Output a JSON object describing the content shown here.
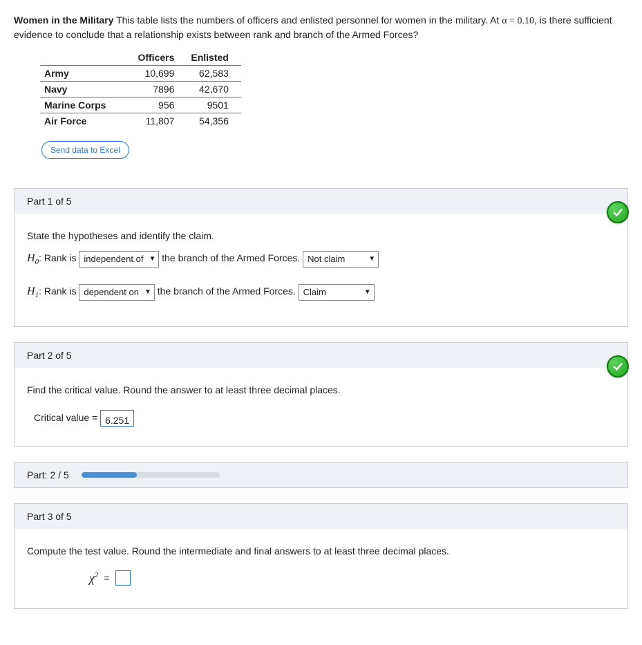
{
  "prompt": {
    "title_bold": "Women in the Military",
    "text_1": " This table lists the numbers of officers and enlisted personnel for women in the military. At ",
    "alpha_expr": "α = 0.10",
    "text_2": ", is there sufficient evidence to conclude that a relationship exists between rank and branch of the Armed Forces?"
  },
  "table": {
    "headers": {
      "c1": "Officers",
      "c2": "Enlisted"
    },
    "rows": [
      {
        "label": "Army",
        "c1": "10,699",
        "c2": "62,583"
      },
      {
        "label": "Navy",
        "c1": "7896",
        "c2": "42,670"
      },
      {
        "label": "Marine Corps",
        "c1": "956",
        "c2": "9501"
      },
      {
        "label": "Air Force",
        "c1": "11,807",
        "c2": "54,356"
      }
    ]
  },
  "excel_button": "Send data to Excel",
  "part1": {
    "header": "Part 1 of 5",
    "instruction": "State the hypotheses and identify the claim.",
    "h0_label": "H",
    "h0_sub": "0",
    "h1_label": "H",
    "h1_sub": "1",
    "rank_is": ": Rank is ",
    "h0_select": "independent of",
    "h1_select": "dependent on",
    "mid_text": " the branch of the Armed Forces. ",
    "h0_claim": "Not claim",
    "h1_claim": "Claim"
  },
  "part2": {
    "header": "Part 2 of 5",
    "instruction": "Find the critical value. Round the answer to at least three decimal places.",
    "label": "Critical value = ",
    "value": "6.251"
  },
  "progress": {
    "label": "Part: 2 / 5",
    "percent": 40
  },
  "part3": {
    "header": "Part 3 of 5",
    "instruction": "Compute the test value. Round the intermediate and final answers to at least three decimal places.",
    "chi": "χ",
    "sup": "2",
    "eq": " = ",
    "value": ""
  },
  "chart_data": {
    "type": "table",
    "title": "Women in the Military — Officers vs Enlisted by Branch",
    "categories": [
      "Army",
      "Navy",
      "Marine Corps",
      "Air Force"
    ],
    "series": [
      {
        "name": "Officers",
        "values": [
          10699,
          7896,
          956,
          11807
        ]
      },
      {
        "name": "Enlisted",
        "values": [
          62583,
          42670,
          9501,
          54356
        ]
      }
    ]
  }
}
